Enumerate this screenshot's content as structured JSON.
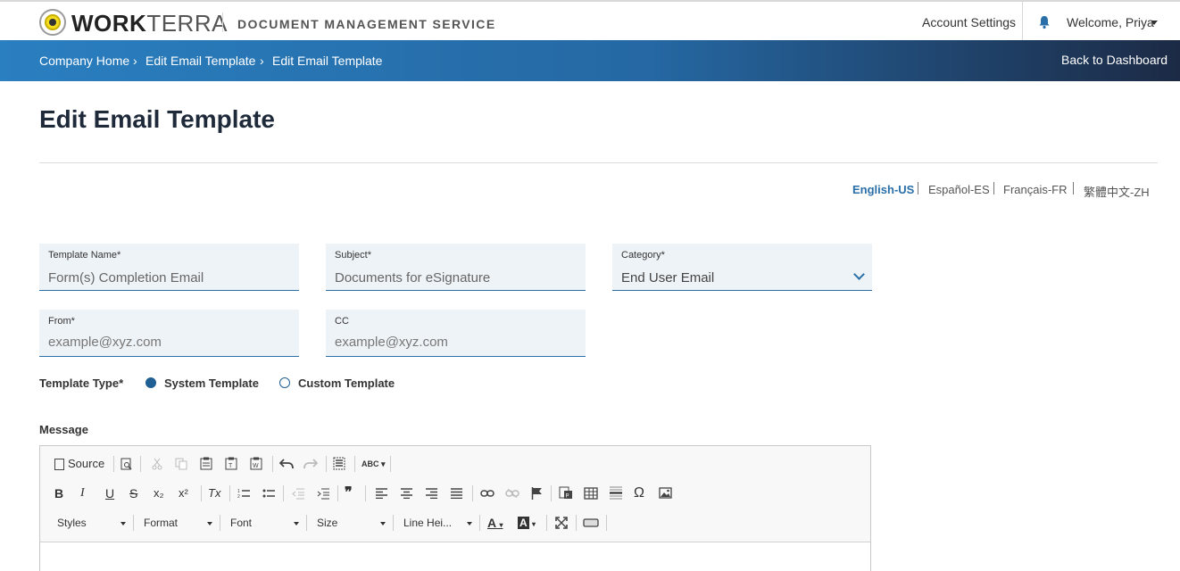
{
  "header": {
    "brand_bold": "WORK",
    "brand_light": "TERRA",
    "service": "DOCUMENT MANAGEMENT SERVICE",
    "account_settings": "Account Settings",
    "welcome": "Welcome, Priya"
  },
  "breadcrumb": {
    "items": [
      "Company Home",
      "Edit Email Template",
      "Edit Email Template"
    ],
    "separator": "›",
    "back": "Back to Dashboard"
  },
  "page": {
    "title": "Edit Email Template"
  },
  "languages": [
    "English-US",
    "Español-ES",
    "Français-FR",
    "繁體中文-ZH"
  ],
  "form": {
    "template_name": {
      "label": "Template Name*",
      "value": "Form(s) Completion Email"
    },
    "subject": {
      "label": "Subject*",
      "value": "Documents for eSignature"
    },
    "category": {
      "label": "Category*",
      "value": "End User Email"
    },
    "from": {
      "label": "From*",
      "placeholder": "example@xyz.com"
    },
    "cc": {
      "label": "CC",
      "placeholder": "example@xyz.com"
    },
    "template_type": {
      "label": "Template Type*",
      "options": [
        "System Template",
        "Custom Template"
      ],
      "selected": "System Template"
    },
    "message_label": "Message"
  },
  "editor": {
    "source": "Source",
    "row1_icons": [
      "preview-icon",
      "cut-icon",
      "copy-icon",
      "paste-icon",
      "paste-text-icon",
      "paste-word-icon",
      "undo-icon",
      "redo-icon",
      "select-all-icon",
      "spellcheck-icon"
    ],
    "bold": "B",
    "italic": "I",
    "underline": "U",
    "strike": "S",
    "subscript": "x₂",
    "superscript": "x²",
    "remove_format": "Tx",
    "quote": "❞",
    "omega": "Ω",
    "spell": "ABC",
    "combos": [
      "Styles",
      "Format",
      "Font",
      "Size",
      "Line Hei..."
    ],
    "font_color": "A",
    "bg_color": "A"
  },
  "colors": {
    "accent": "#2a6fa8",
    "bar_start": "#2a7fc0",
    "bar_end": "#1c2a45",
    "field_bg": "#eef3f8"
  }
}
